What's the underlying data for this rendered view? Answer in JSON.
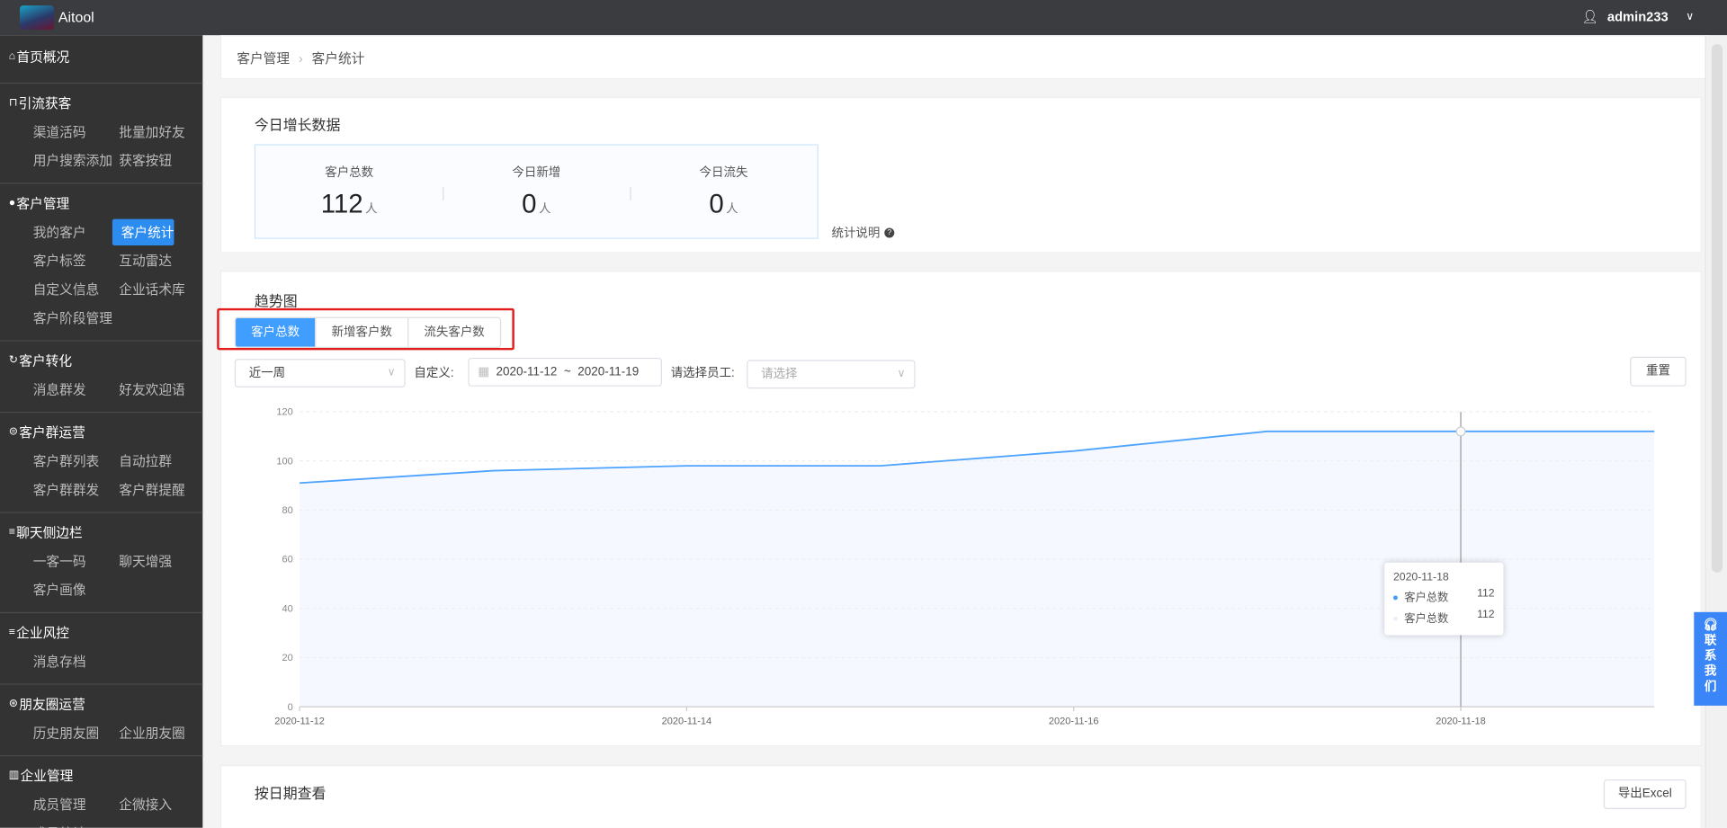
{
  "app": {
    "name": "Aitool",
    "user": "admin233"
  },
  "sidebar": [
    {
      "icon": "home-icon",
      "glyph": "⌂",
      "title": "首页概况",
      "items": []
    },
    {
      "icon": "magnet-icon",
      "glyph": "⊓",
      "title": "引流获客",
      "items": [
        "渠道活码",
        "批量加好友",
        "用户搜索添加",
        "获客按钮"
      ]
    },
    {
      "icon": "user-icon",
      "glyph": "●",
      "title": "客户管理",
      "items": [
        "我的客户",
        "客户统计",
        "客户标签",
        "互动雷达",
        "自定义信息",
        "企业话术库",
        "客户阶段管理"
      ]
    },
    {
      "icon": "refresh-icon",
      "glyph": "↻",
      "title": "客户转化",
      "items": [
        "消息群发",
        "好友欢迎语"
      ]
    },
    {
      "icon": "chat-icon",
      "glyph": "⊜",
      "title": "客户群运营",
      "items": [
        "客户群列表",
        "自动拉群",
        "客户群群发",
        "客户群提醒"
      ]
    },
    {
      "icon": "menu-icon",
      "glyph": "≡",
      "title": "聊天侧边栏",
      "items": [
        "一客一码",
        "聊天增强",
        "客户画像"
      ]
    },
    {
      "icon": "menu-icon",
      "glyph": "≡",
      "title": "企业风控",
      "items": [
        "消息存档"
      ]
    },
    {
      "icon": "aperture-icon",
      "glyph": "⊛",
      "title": "朋友圈运营",
      "items": [
        "历史朋友圈",
        "企业朋友圈"
      ]
    },
    {
      "icon": "building-icon",
      "glyph": "▥",
      "title": "企业管理",
      "items": [
        "成员管理",
        "企微接入",
        "成员统计"
      ]
    }
  ],
  "active_item": "客户统计",
  "breadcrumb": [
    "客户管理",
    "客户统计"
  ],
  "today": {
    "title": "今日增长数据",
    "stats": [
      {
        "label": "客户总数",
        "value": "112",
        "unit": "人"
      },
      {
        "label": "今日新增",
        "value": "0",
        "unit": "人"
      },
      {
        "label": "今日流失",
        "value": "0",
        "unit": "人"
      }
    ],
    "help": "统计说明"
  },
  "trend": {
    "title": "趋势图",
    "tabs": [
      "客户总数",
      "新增客户数",
      "流失客户数"
    ],
    "active_tab": 0,
    "period": "近一周",
    "custom_label": "自定义:",
    "date_start": "2020-11-12",
    "date_sep": "~",
    "date_end": "2020-11-19",
    "staff_label": "请选择员工:",
    "staff_placeholder": "请选择",
    "reset": "重置",
    "tooltip": {
      "date": "2020-11-18",
      "rows": [
        {
          "name": "客户总数",
          "value": "112"
        },
        {
          "name": "客户总数",
          "value": "112"
        }
      ]
    }
  },
  "by_date": {
    "title": "按日期查看",
    "export": "导出Excel"
  },
  "contact": "联系我们",
  "colors": {
    "accent": "#409eff",
    "line": "#4da3ff",
    "sidebar": "#333333",
    "highlight": "#e21b1b"
  },
  "chart_data": {
    "type": "area",
    "title": "",
    "xlabel": "",
    "ylabel": "",
    "x": [
      "2020-11-12",
      "2020-11-13",
      "2020-11-14",
      "2020-11-15",
      "2020-11-16",
      "2020-11-17",
      "2020-11-18",
      "2020-11-19"
    ],
    "series": [
      {
        "name": "客户总数",
        "values": [
          91,
          96,
          98,
          98,
          104,
          112,
          112,
          112
        ]
      }
    ],
    "xticks": [
      "2020-11-12",
      "2020-11-14",
      "2020-11-16",
      "2020-11-18"
    ],
    "yticks": [
      0,
      20,
      40,
      60,
      80,
      100,
      120
    ],
    "ylim": [
      0,
      120
    ],
    "grid": true,
    "highlight_x": "2020-11-18"
  }
}
